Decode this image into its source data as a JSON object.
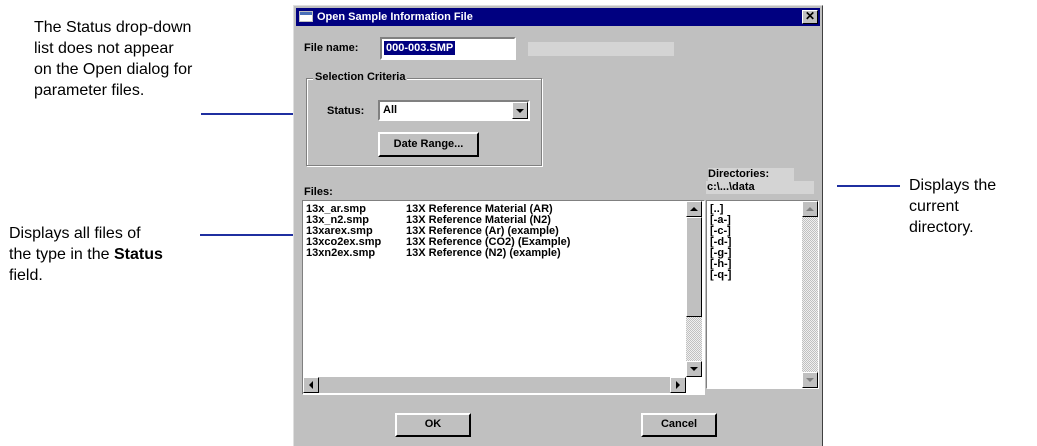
{
  "annotations": {
    "status_note": [
      "The Status drop-down",
      "list does not appear",
      "on the Open dialog for",
      "parameter files."
    ],
    "files_note_line1": "Displays all files of",
    "files_note_line2_pre": "the type in the ",
    "files_note_line2_bold": "Status",
    "files_note_line3": "field.",
    "dir_note": [
      "Displays the",
      "current",
      "directory."
    ]
  },
  "dialog": {
    "title": "Open Sample Information File",
    "close_glyph": "✕",
    "file_name_label": "File name:",
    "file_name_value": "000-003.SMP",
    "selection_criteria_label": "Selection Criteria",
    "status_label": "Status:",
    "status_value": "All",
    "date_range_label": "Date Range...",
    "files_label": "Files:",
    "directories_label": "Directories:",
    "current_directory": "c:\\...\\data",
    "files": [
      {
        "name": "13x_ar.smp",
        "desc": "13X Reference Material (AR)"
      },
      {
        "name": "13x_n2.smp",
        "desc": "13X Reference Material (N2)"
      },
      {
        "name": "13xarex.smp",
        "desc": "13X Reference (Ar) (example)"
      },
      {
        "name": "13xco2ex.smp",
        "desc": "13X Reference (CO2) (Example)"
      },
      {
        "name": "13xn2ex.smp",
        "desc": "13X Reference (N2) (example)"
      }
    ],
    "directories": [
      "[..]",
      "[-a-]",
      "[-c-]",
      "[-d-]",
      "[-g-]",
      "[-h-]",
      "[-q-]"
    ],
    "ok_label": "OK",
    "cancel_label": "Cancel"
  },
  "colors": {
    "titlebar": "#000080",
    "callout_line": "#1f2fa0",
    "dialog_face": "#c0c0c0"
  }
}
